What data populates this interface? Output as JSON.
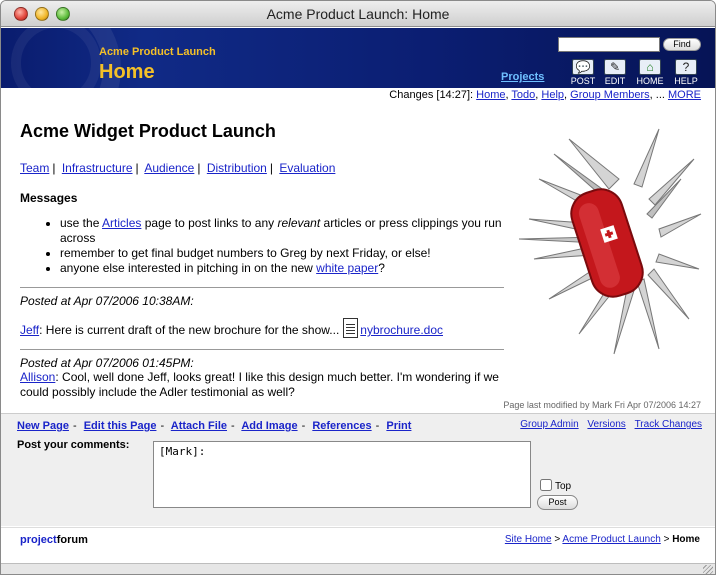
{
  "window": {
    "title": "Acme Product Launch: Home"
  },
  "header": {
    "subtitle": "Acme Product Launch",
    "title": "Home",
    "projects_link": "Projects",
    "search": {
      "value": "",
      "placeholder": ""
    },
    "find_label": "Find",
    "tools": [
      {
        "label": "POST",
        "icon": "speech-bubble-icon",
        "glyph": "💬"
      },
      {
        "label": "EDIT",
        "icon": "pencil-edit-icon",
        "glyph": "✎"
      },
      {
        "label": "HOME",
        "icon": "house-icon",
        "glyph": "⌂"
      },
      {
        "label": "HELP",
        "icon": "question-icon",
        "glyph": "?"
      }
    ]
  },
  "changes": {
    "prefix": "Changes [14:27]:",
    "links": [
      "Home",
      "Todo",
      "Help",
      "Group Members"
    ],
    "ellipsis": "...",
    "more": "MORE"
  },
  "main": {
    "title": "Acme Widget Product Launch",
    "nav": [
      "Team",
      "Infrastructure",
      "Audience",
      "Distribution",
      "Evaluation"
    ],
    "messages_heading": "Messages",
    "messages": {
      "m1_pre": "use the ",
      "m1_link": "Articles",
      "m1_mid": " page to post links to any ",
      "m1_em": "relevant",
      "m1_post": " articles or press clippings you run across",
      "m2": "remember to get final budget numbers to Greg by next Friday, or else!",
      "m3_pre": "anyone else interested in pitching in on the new ",
      "m3_link": "white paper",
      "m3_post": "?"
    },
    "posts": [
      {
        "date": "Posted at Apr 07/2006 10:38AM:",
        "author": "Jeff",
        "text": ": Here is current draft of the new brochure for the show...",
        "attachment": "nybrochure.doc"
      },
      {
        "date": "Posted at Apr 07/2006 01:45PM:",
        "author": "Allison",
        "text": ": Cool, well done Jeff, looks great! I like this design much better. I'm wondering if we could possibly include the Adler testimonial as well?"
      }
    ],
    "last_modified": "Page last modified by Mark Fri Apr 07/2006 14:27"
  },
  "actions": {
    "links": [
      "New Page",
      "Edit this Page",
      "Attach File",
      "Add Image",
      "References",
      "Print"
    ],
    "right_links": [
      "Group Admin",
      "Versions",
      "Track Changes"
    ],
    "post_label": "Post your comments:",
    "comment_value": "[Mark]:",
    "top_label": "Top",
    "post_button": "Post"
  },
  "footer": {
    "logo_a": "project",
    "logo_b": "forum",
    "crumbs": [
      "Site Home",
      "Acme Product Launch"
    ],
    "crumb_sep": ">",
    "current": "Home"
  },
  "colors": {
    "banner": "#0b1e72",
    "banner_text": "#f4c028",
    "link": "#1a24c9",
    "knife_red": "#c4171c"
  }
}
